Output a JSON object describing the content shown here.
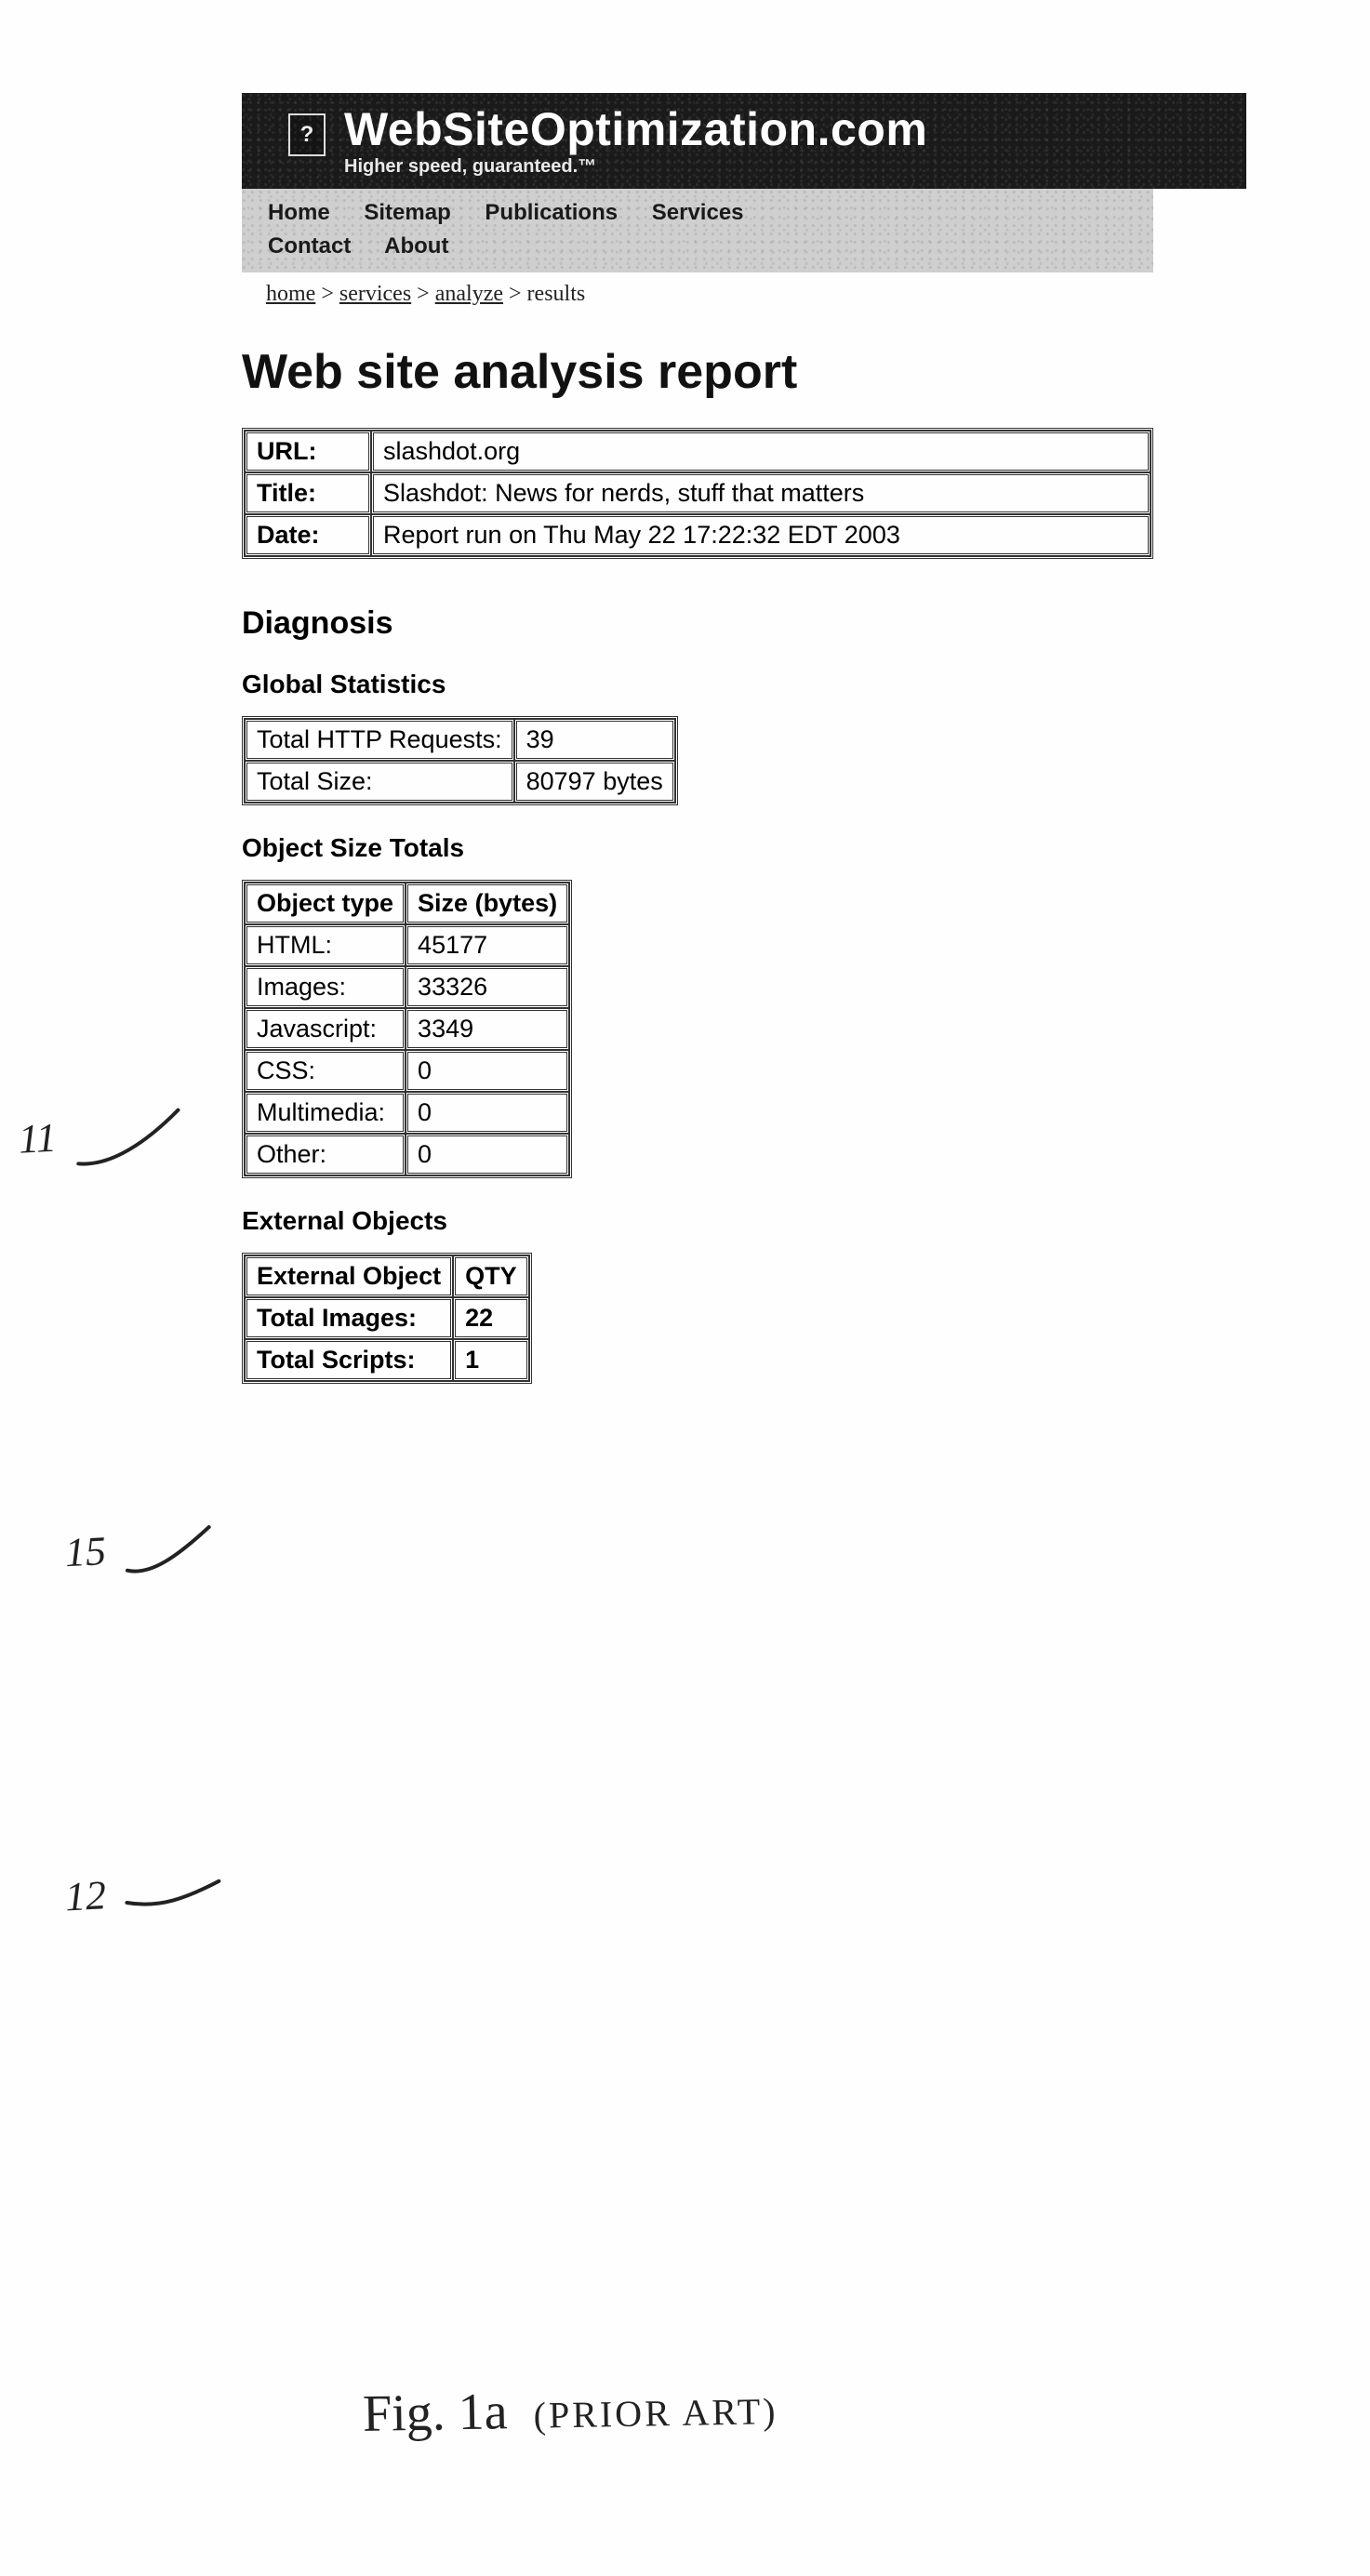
{
  "banner": {
    "icon_glyph": "?",
    "title": "WebSiteOptimization.com",
    "tagline": "Higher speed, guaranteed.™"
  },
  "nav": {
    "items": [
      "Home",
      "Sitemap",
      "Publications",
      "Services",
      "Contact",
      "About"
    ]
  },
  "breadcrumb": {
    "parts": [
      "home",
      "services",
      "analyze",
      "results"
    ],
    "sep": " > "
  },
  "page_title": "Web site analysis report",
  "info": {
    "rows": [
      {
        "label": "URL:",
        "value": "slashdot.org"
      },
      {
        "label": "Title:",
        "value": "Slashdot: News for nerds, stuff that matters"
      },
      {
        "label": "Date:",
        "value": "Report run on Thu May 22 17:22:32 EDT 2003"
      }
    ]
  },
  "diagnosis_heading": "Diagnosis",
  "global_stats": {
    "heading": "Global Statistics",
    "rows": [
      {
        "label": "Total HTTP Requests:",
        "value": "39"
      },
      {
        "label": "Total Size:",
        "value": "80797 bytes"
      }
    ]
  },
  "object_sizes": {
    "heading": "Object Size Totals",
    "cols": [
      "Object type",
      "Size (bytes)"
    ],
    "rows": [
      {
        "type": "HTML:",
        "size": "45177"
      },
      {
        "type": "Images:",
        "size": "33326"
      },
      {
        "type": "Javascript:",
        "size": "3349"
      },
      {
        "type": "CSS:",
        "size": "0"
      },
      {
        "type": "Multimedia:",
        "size": "0"
      },
      {
        "type": "Other:",
        "size": "0"
      }
    ]
  },
  "external": {
    "heading": "External Objects",
    "cols": [
      "External Object",
      "QTY"
    ],
    "rows": [
      {
        "label": "Total Images:",
        "qty": "22"
      },
      {
        "label": "Total Scripts:",
        "qty": "1"
      }
    ]
  },
  "annotations": {
    "a11": "11",
    "a15": "15",
    "a12": "12",
    "caption_a": "Fig. 1a",
    "caption_b": "(PRIOR ART)"
  }
}
